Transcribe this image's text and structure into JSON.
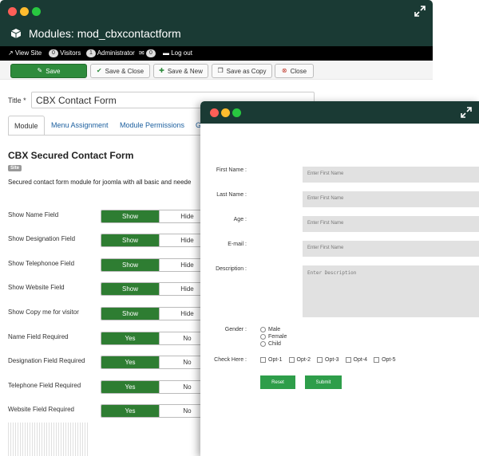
{
  "back": {
    "module_header": "Modules: mod_cbxcontactform",
    "status": {
      "view_site": "View Site",
      "visitors_count": "0",
      "visitors_label": "Visitors",
      "admin_count": "1",
      "admin_label": "Administrator",
      "messages_count": "0",
      "logout": "Log out"
    },
    "toolbar": {
      "save": "Save",
      "save_close": "Save & Close",
      "save_new": "Save & New",
      "save_copy": "Save as Copy",
      "close": "Close"
    },
    "title_label": "Title *",
    "title_value": "CBX Contact Form",
    "tabs": [
      "Module",
      "Menu Assignment",
      "Module Permissions",
      "G"
    ],
    "form_heading": "CBX Secured Contact Form",
    "site_badge": "Site",
    "description": "Secured contact form module for joomla with all basic and neede",
    "fields": [
      {
        "label": "Show Name Field",
        "on": "Show",
        "off": "Hide"
      },
      {
        "label": "Show Designation Field",
        "on": "Show",
        "off": "Hide"
      },
      {
        "label": "Show Telephonoe Field",
        "on": "Show",
        "off": "Hide"
      },
      {
        "label": "Show Website Field",
        "on": "Show",
        "off": "Hide"
      },
      {
        "label": "Show Copy me for visitor",
        "on": "Show",
        "off": "Hide"
      },
      {
        "label": "Name Field Required",
        "on": "Yes",
        "off": "No"
      },
      {
        "label": "Designation Field Required",
        "on": "Yes",
        "off": "No"
      },
      {
        "label": "Telephone Field Required",
        "on": "Yes",
        "off": "No"
      },
      {
        "label": "Website Field Required",
        "on": "Yes",
        "off": "No"
      }
    ]
  },
  "front": {
    "first_name_label": "First Name :",
    "first_name_placeholder": "Enter First Name",
    "last_name_label": "Last Name :",
    "last_name_placeholder": "Enter First Name",
    "age_label": "Age :",
    "age_placeholder": "Enter First Name",
    "email_label": "E-mail :",
    "email_placeholder": "Enter First Name",
    "description_label": "Description :",
    "description_placeholder": "Enter Description",
    "gender_label": "Gender :",
    "gender_options": [
      "Male",
      "Female",
      "Child"
    ],
    "check_label": "Check Here :",
    "check_options": [
      "Opt-1",
      "Opt-2",
      "Opt-3",
      "Opt-4",
      "Opt-5"
    ],
    "reset": "Reset",
    "submit": "Submit"
  },
  "colors": {
    "titlebar": "#1a3a34",
    "toggle_on": "#2e7d32",
    "button_green": "#2e9e4a",
    "input_gray": "#e1e1e1"
  }
}
